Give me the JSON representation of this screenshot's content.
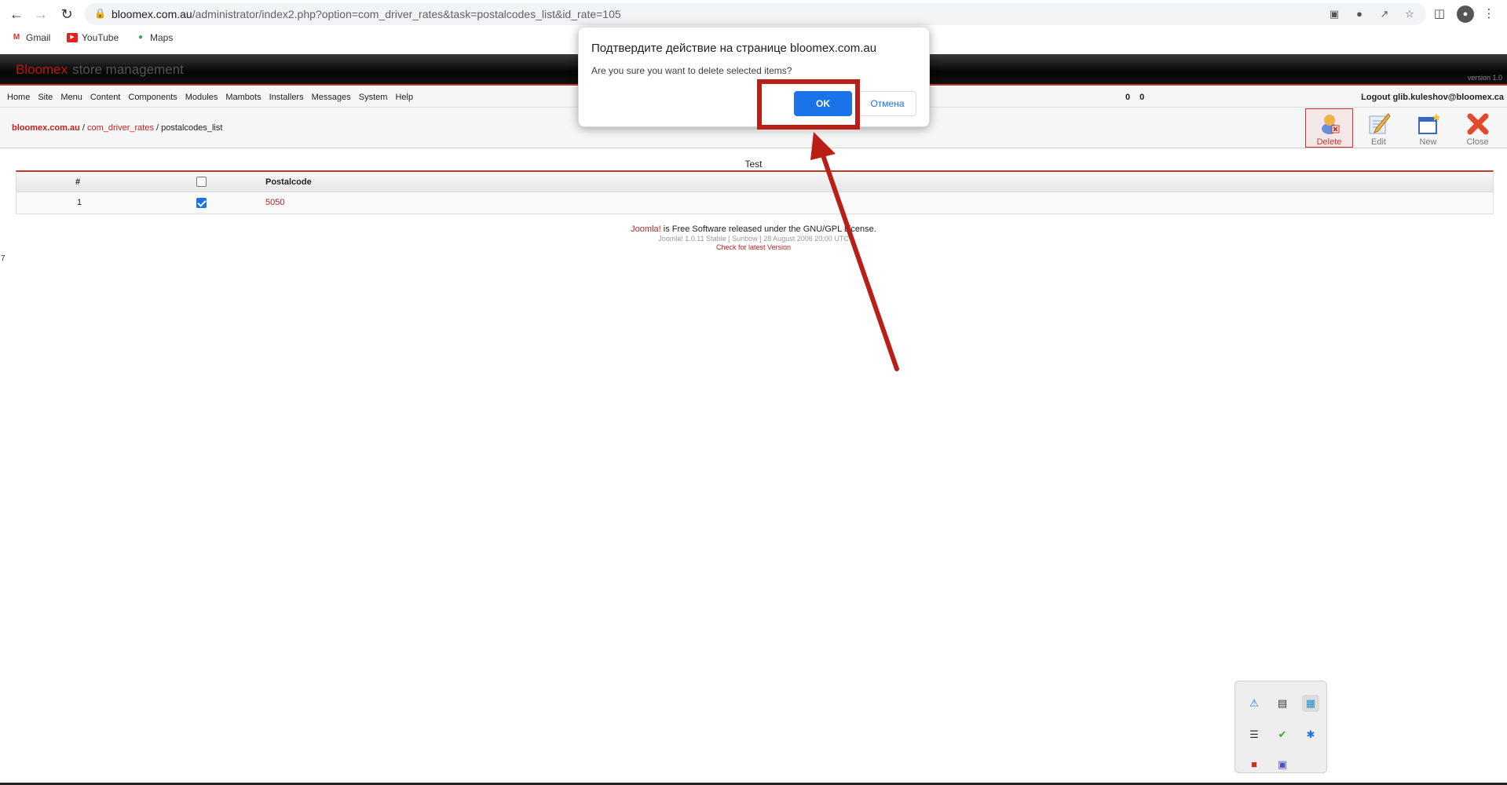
{
  "browser": {
    "url_host": "bloomex.com.au",
    "url_path": "/administrator/index2.php?option=com_driver_rates&task=postalcodes_list&id_rate=105",
    "bookmarks": [
      {
        "label": "Gmail",
        "icon": "gmail-icon"
      },
      {
        "label": "YouTube",
        "icon": "youtube-icon"
      },
      {
        "label": "Maps",
        "icon": "maps-icon"
      }
    ]
  },
  "admin": {
    "brand_main": "Bloomex",
    "brand_sub": "store management",
    "version": "version 1.0",
    "menu": [
      "Home",
      "Site",
      "Menu",
      "Content",
      "Components",
      "Modules",
      "Mambots",
      "Installers",
      "Messages",
      "System",
      "Help"
    ],
    "counter_a": "0",
    "counter_b": "0",
    "logout": "Logout glib.kuleshov@bloomex.ca",
    "breadcrumb": {
      "root": "bloomex.com.au",
      "sep1": " / ",
      "component": "com_driver_rates",
      "sep2": " / ",
      "task": "postalcodes_list"
    },
    "toolbar": {
      "delete": "Delete",
      "edit": "Edit",
      "new": "New",
      "close": "Close"
    },
    "page_title": "Test",
    "table": {
      "headers": {
        "num": "#",
        "postalcode": "Postalcode"
      },
      "rows": [
        {
          "num": "1",
          "postalcode": "5050",
          "checked": true
        }
      ]
    },
    "footer": {
      "joomla": "Joomla!",
      "license": " is Free Software released under the GNU/GPL License.",
      "version_line": "Joomla! 1.0.11 Stable [ Sunbow ] 28 August 2006 20:00 UTC",
      "check": "Check for latest Version"
    },
    "stray": "7"
  },
  "dialog": {
    "title": "Подтвердите действие на странице bloomex.com.au",
    "message": "Are you sure you want to delete selected items?",
    "ok": "OK",
    "cancel": "Отмена"
  },
  "colors": {
    "accent_red": "#c0392b",
    "dialog_blue": "#1a73e8",
    "annotation_red": "#b81f16"
  }
}
